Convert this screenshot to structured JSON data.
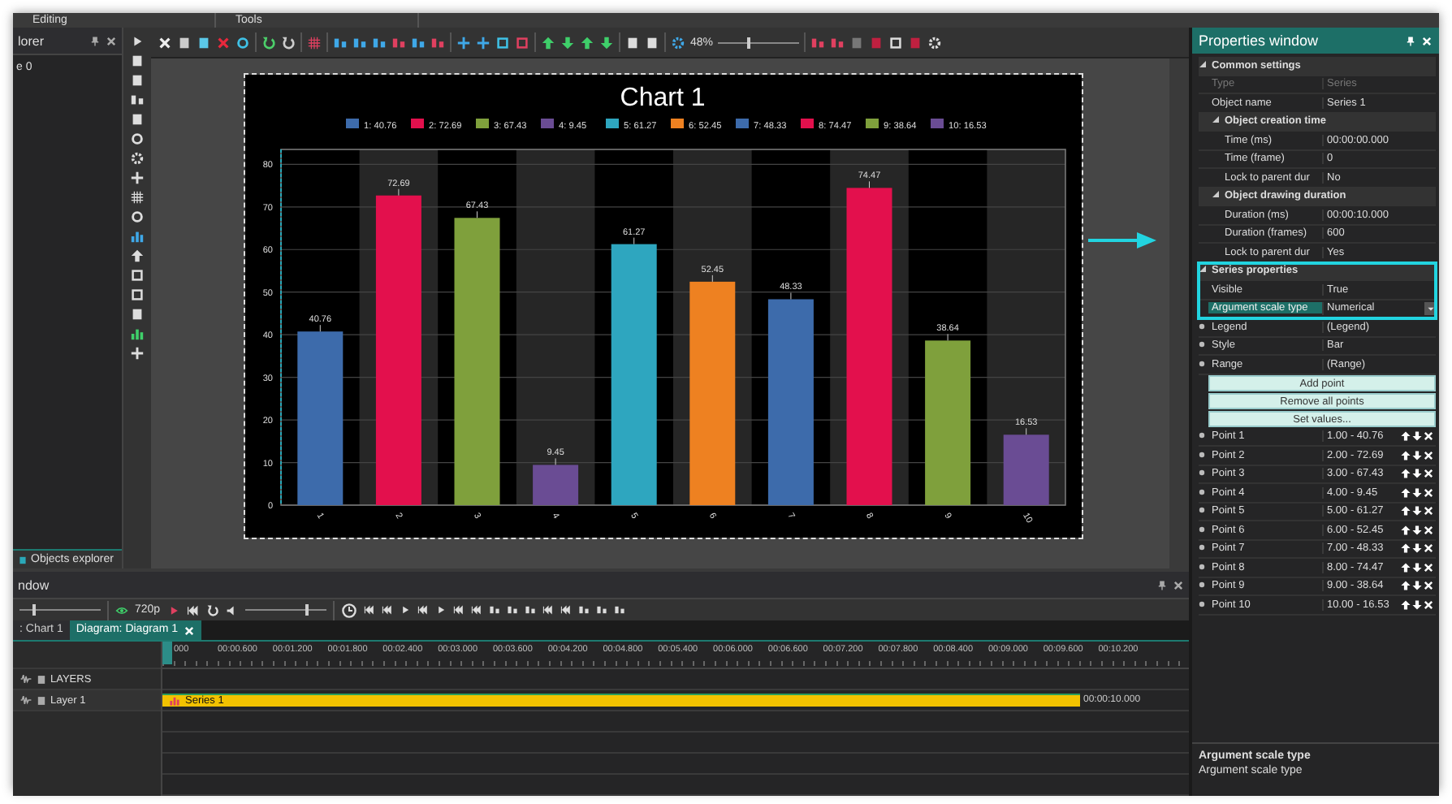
{
  "menu_tabs": [
    "Editing",
    "Tools"
  ],
  "explorer": {
    "title": "lorer",
    "items": [
      "e 0"
    ],
    "bottom_tab": "Objects explorer"
  },
  "toolbar": {
    "zoom": "48%",
    "zoom_slider": {
      "level": 0.35
    }
  },
  "chart": {
    "legend": [
      {
        "label": "1: 40.76",
        "color": "#3d6bab"
      },
      {
        "label": "2: 72.69",
        "color": "#e3104d"
      },
      {
        "label": "3: 67.43",
        "color": "#7fa03c"
      },
      {
        "label": "4: 9.45",
        "color": "#6a4c94"
      },
      {
        "label": "5: 61.27",
        "color": "#2ea6bf"
      },
      {
        "label": "6: 52.45",
        "color": "#ee8121"
      },
      {
        "label": "7: 48.33",
        "color": "#3d6bab"
      },
      {
        "label": "8: 74.47",
        "color": "#e3104d"
      },
      {
        "label": "9: 38.64",
        "color": "#7fa03c"
      },
      {
        "label": "10: 16.53",
        "color": "#6a4c94"
      }
    ],
    "chart_data": {
      "type": "bar",
      "title": "Chart 1",
      "categories": [
        "1",
        "2",
        "3",
        "4",
        "5",
        "6",
        "7",
        "8",
        "9",
        "10"
      ],
      "series": [
        {
          "values": [
            40.76,
            72.69,
            67.43,
            9.45,
            61.27,
            52.45,
            48.33,
            74.47,
            38.64,
            16.53
          ]
        }
      ],
      "ylim": [
        0,
        83.5
      ],
      "grid": true,
      "yticks": [
        0,
        10,
        20,
        30,
        40,
        50,
        60,
        70,
        80
      ],
      "data_labels": true
    }
  },
  "properties": {
    "title": "Properties window",
    "rows": [
      {
        "kind": "group",
        "label": "Common settings",
        "expanded": true
      },
      {
        "kind": "prop",
        "label": "Type",
        "value": "Series",
        "disabled": true
      },
      {
        "kind": "prop",
        "label": "Object name",
        "value": "Series 1",
        "disabled": false
      },
      {
        "kind": "subgroup",
        "label": "Object creation time",
        "expanded": true
      },
      {
        "kind": "subprop",
        "label": "Time (ms)",
        "value": "00:00:00.000",
        "disabled": false
      },
      {
        "kind": "subprop",
        "label": "Time (frame)",
        "value": "0",
        "disabled": false
      },
      {
        "kind": "subprop",
        "label": "Lock to parent dur",
        "value": "No",
        "disabled": false
      },
      {
        "kind": "subgroup",
        "label": "Object drawing duration",
        "expanded": true
      },
      {
        "kind": "subprop",
        "label": "Duration (ms)",
        "value": "00:00:10.000",
        "disabled": false
      },
      {
        "kind": "subprop",
        "label": "Duration (frames)",
        "value": "600",
        "disabled": false
      },
      {
        "kind": "subprop",
        "label": "Lock to parent dur",
        "value": "Yes",
        "disabled": false
      },
      {
        "kind": "group",
        "label": "Series properties",
        "expanded": true,
        "highlight": true
      },
      {
        "kind": "prop",
        "label": "Visible",
        "value": "True",
        "disabled": false,
        "highlight": true
      },
      {
        "kind": "select",
        "label": "Argument scale type",
        "value": "Numerical",
        "selected": true,
        "highlight": true
      },
      {
        "kind": "prop",
        "label": "Legend",
        "value": "(Legend)",
        "expanded": false,
        "disabled": false
      },
      {
        "kind": "prop",
        "label": "Style",
        "value": "Bar",
        "expanded": false,
        "disabled": false
      },
      {
        "kind": "prop",
        "label": "Range",
        "value": "(Range)",
        "expanded": false,
        "disabled": false
      },
      {
        "kind": "button",
        "label": "Add point"
      },
      {
        "kind": "button",
        "label": "Remove all points"
      },
      {
        "kind": "button",
        "label": "Set values..."
      },
      {
        "kind": "point",
        "label": "Point 1",
        "value": "1.00 - 40.76",
        "expanded": false
      },
      {
        "kind": "point",
        "label": "Point 2",
        "value": "2.00 - 72.69",
        "expanded": false
      },
      {
        "kind": "point",
        "label": "Point 3",
        "value": "3.00 - 67.43",
        "expanded": false
      },
      {
        "kind": "point",
        "label": "Point 4",
        "value": "4.00 - 9.45",
        "expanded": false
      },
      {
        "kind": "point",
        "label": "Point 5",
        "value": "5.00 - 61.27",
        "expanded": false
      },
      {
        "kind": "point",
        "label": "Point 6",
        "value": "6.00 - 52.45",
        "expanded": false
      },
      {
        "kind": "point",
        "label": "Point 7",
        "value": "7.00 - 48.33",
        "expanded": false
      },
      {
        "kind": "point",
        "label": "Point 8",
        "value": "8.00 - 74.47",
        "expanded": false
      },
      {
        "kind": "point",
        "label": "Point 9",
        "value": "9.00 - 38.64",
        "expanded": false
      },
      {
        "kind": "point",
        "label": "Point 10",
        "value": "10.00 - 16.53",
        "expanded": false
      }
    ],
    "description": {
      "title": "Argument scale type",
      "text": "Argument scale type"
    }
  },
  "timeline": {
    "title": "ndow",
    "resolution": "720p",
    "zoom_slider": {
      "level": 0.15
    },
    "volume_slider": {
      "level": 0.75
    },
    "tabs": [
      {
        "label": ": Chart 1",
        "selected": false,
        "closable": false
      },
      {
        "label": "Diagram: Diagram 1",
        "selected": true,
        "closable": true
      }
    ],
    "ticks": [
      "000",
      "00:00.600",
      "00:01.200",
      "00:01.800",
      "00:02.400",
      "00:03.000",
      "00:03.600",
      "00:04.200",
      "00:04.800",
      "00:05.400",
      "00:06.000",
      "00:06.600",
      "00:07.200",
      "00:07.800",
      "00:08.400",
      "00:09.000",
      "00:09.600",
      "00:10.200"
    ],
    "layers_header": "LAYERS",
    "layers": [
      {
        "name": "Layer 1",
        "clip": "Series 1",
        "end": "00:00:10.000"
      }
    ]
  }
}
